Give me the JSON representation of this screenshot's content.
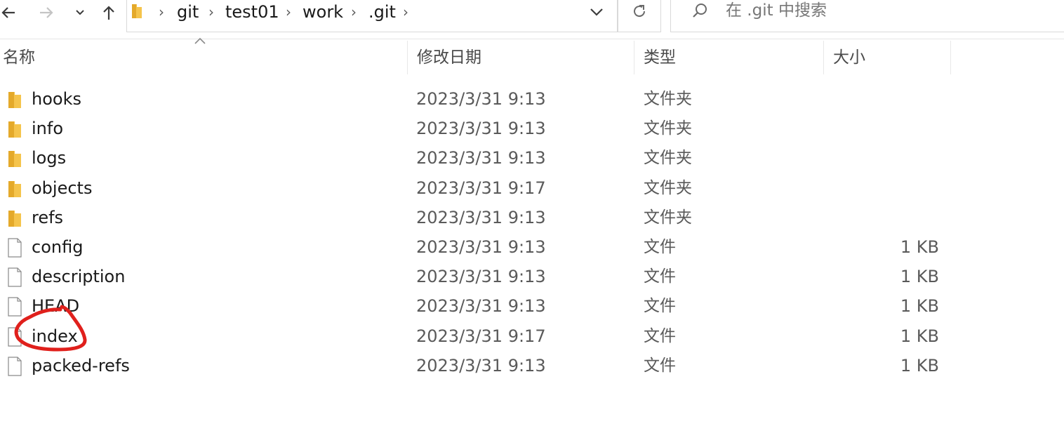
{
  "nav": {
    "back_icon": "back-arrow-icon",
    "forward_icon": "forward-arrow-icon",
    "recent_icon": "chevron-down-icon",
    "up_icon": "up-arrow-icon"
  },
  "address": {
    "crumbs": [
      "git",
      "test01",
      "work",
      ".git"
    ],
    "separator": "›"
  },
  "refresh_icon": "refresh-icon",
  "search": {
    "placeholder": "在 .git 中搜索"
  },
  "columns": {
    "name": "名称",
    "modified": "修改日期",
    "type": "类型",
    "size": "大小"
  },
  "files": [
    {
      "name": "hooks",
      "modified": "2023/3/31 9:13",
      "type": "文件夹",
      "size": "",
      "icon": "folder-icon"
    },
    {
      "name": "info",
      "modified": "2023/3/31 9:13",
      "type": "文件夹",
      "size": "",
      "icon": "folder-icon"
    },
    {
      "name": "logs",
      "modified": "2023/3/31 9:13",
      "type": "文件夹",
      "size": "",
      "icon": "folder-icon"
    },
    {
      "name": "objects",
      "modified": "2023/3/31 9:17",
      "type": "文件夹",
      "size": "",
      "icon": "folder-icon"
    },
    {
      "name": "refs",
      "modified": "2023/3/31 9:13",
      "type": "文件夹",
      "size": "",
      "icon": "folder-icon"
    },
    {
      "name": "config",
      "modified": "2023/3/31 9:13",
      "type": "文件",
      "size": "1 KB",
      "icon": "file-icon"
    },
    {
      "name": "description",
      "modified": "2023/3/31 9:13",
      "type": "文件",
      "size": "1 KB",
      "icon": "file-icon"
    },
    {
      "name": "HEAD",
      "modified": "2023/3/31 9:13",
      "type": "文件",
      "size": "1 KB",
      "icon": "file-icon"
    },
    {
      "name": "index",
      "modified": "2023/3/31 9:17",
      "type": "文件",
      "size": "1 KB",
      "icon": "file-icon"
    },
    {
      "name": "packed-refs",
      "modified": "2023/3/31 9:13",
      "type": "文件",
      "size": "1 KB",
      "icon": "file-icon"
    }
  ],
  "colors": {
    "folder": "#f5c44c",
    "annotation": "#e0201c"
  }
}
